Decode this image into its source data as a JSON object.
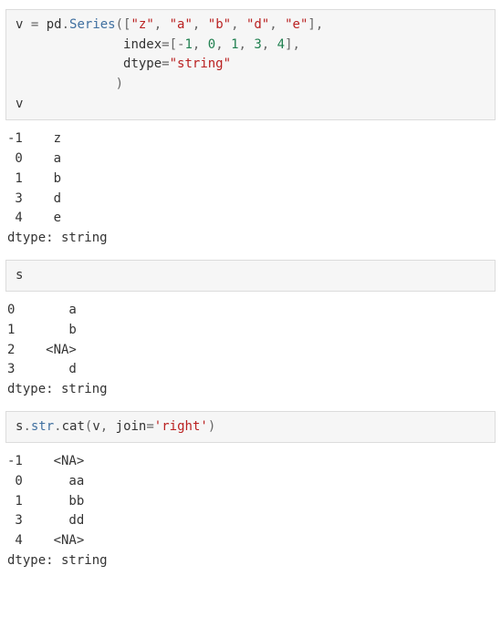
{
  "cells": [
    {
      "kind": "code",
      "tokens": [
        {
          "t": "v ",
          "c": "tk-obj"
        },
        {
          "t": "=",
          "c": "tk-punc"
        },
        {
          "t": " pd",
          "c": "tk-obj"
        },
        {
          "t": ".",
          "c": "tk-dot"
        },
        {
          "t": "Series",
          "c": "tk-attr"
        },
        {
          "t": "([",
          "c": "tk-punc"
        },
        {
          "t": "\"z\"",
          "c": "tk-str"
        },
        {
          "t": ", ",
          "c": "tk-punc"
        },
        {
          "t": "\"a\"",
          "c": "tk-str"
        },
        {
          "t": ", ",
          "c": "tk-punc"
        },
        {
          "t": "\"b\"",
          "c": "tk-str"
        },
        {
          "t": ", ",
          "c": "tk-punc"
        },
        {
          "t": "\"d\"",
          "c": "tk-str"
        },
        {
          "t": ", ",
          "c": "tk-punc"
        },
        {
          "t": "\"e\"",
          "c": "tk-str"
        },
        {
          "t": "],",
          "c": "tk-punc"
        },
        {
          "nl": true
        },
        {
          "t": "              ",
          "c": "tk-obj"
        },
        {
          "t": "index",
          "c": "tk-kw"
        },
        {
          "t": "=[",
          "c": "tk-punc"
        },
        {
          "t": "-",
          "c": "tk-punc"
        },
        {
          "t": "1",
          "c": "tk-num"
        },
        {
          "t": ", ",
          "c": "tk-punc"
        },
        {
          "t": "0",
          "c": "tk-num"
        },
        {
          "t": ", ",
          "c": "tk-punc"
        },
        {
          "t": "1",
          "c": "tk-num"
        },
        {
          "t": ", ",
          "c": "tk-punc"
        },
        {
          "t": "3",
          "c": "tk-num"
        },
        {
          "t": ", ",
          "c": "tk-punc"
        },
        {
          "t": "4",
          "c": "tk-num"
        },
        {
          "t": "],",
          "c": "tk-punc"
        },
        {
          "nl": true
        },
        {
          "t": "              ",
          "c": "tk-obj"
        },
        {
          "t": "dtype",
          "c": "tk-kw"
        },
        {
          "t": "=",
          "c": "tk-punc"
        },
        {
          "t": "\"string\"",
          "c": "tk-str"
        },
        {
          "nl": true
        },
        {
          "t": "             )",
          "c": "tk-punc"
        },
        {
          "nl": true
        },
        {
          "t": "v",
          "c": "tk-obj"
        }
      ]
    },
    {
      "kind": "output",
      "lines": [
        "-1    z",
        " 0    a",
        " 1    b",
        " 3    d",
        " 4    e",
        "dtype: string"
      ]
    },
    {
      "kind": "code",
      "tokens": [
        {
          "t": "s",
          "c": "tk-obj"
        }
      ]
    },
    {
      "kind": "output",
      "lines": [
        "0       a",
        "1       b",
        "2    <NA>",
        "3       d",
        "dtype: string"
      ]
    },
    {
      "kind": "code",
      "tokens": [
        {
          "t": "s",
          "c": "tk-obj"
        },
        {
          "t": ".",
          "c": "tk-dot"
        },
        {
          "t": "str",
          "c": "tk-attr"
        },
        {
          "t": ".",
          "c": "tk-dot"
        },
        {
          "t": "cat",
          "c": "tk-call"
        },
        {
          "t": "(",
          "c": "tk-punc"
        },
        {
          "t": "v",
          "c": "tk-obj"
        },
        {
          "t": ", ",
          "c": "tk-punc"
        },
        {
          "t": "join",
          "c": "tk-kw"
        },
        {
          "t": "=",
          "c": "tk-punc"
        },
        {
          "t": "'right'",
          "c": "tk-str"
        },
        {
          "t": ")",
          "c": "tk-punc"
        }
      ]
    },
    {
      "kind": "output",
      "lines": [
        "-1    <NA>",
        " 0      aa",
        " 1      bb",
        " 3      dd",
        " 4    <NA>",
        "dtype: string"
      ]
    }
  ]
}
